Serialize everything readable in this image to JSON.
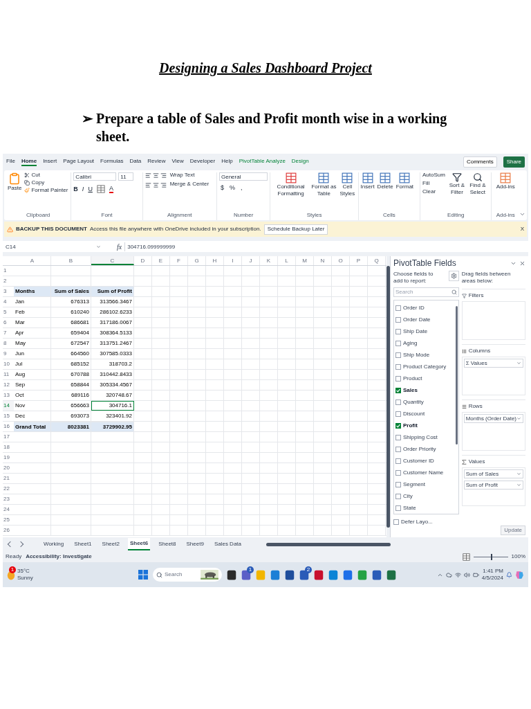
{
  "document": {
    "title": "Designing a Sales Dashboard Project",
    "bullets": [
      {
        "marker": "➢",
        "text": "Prepare a table of Sales and Profit month wise in a working sheet."
      }
    ]
  },
  "excel": {
    "ribbon_tabs": [
      {
        "label": "File",
        "selected": false,
        "kind": "normal"
      },
      {
        "label": "Home",
        "selected": true,
        "kind": "normal"
      },
      {
        "label": "Insert",
        "selected": false,
        "kind": "normal"
      },
      {
        "label": "Page Layout",
        "selected": false,
        "kind": "normal"
      },
      {
        "label": "Formulas",
        "selected": false,
        "kind": "normal"
      },
      {
        "label": "Data",
        "selected": false,
        "kind": "normal"
      },
      {
        "label": "Review",
        "selected": false,
        "kind": "normal"
      },
      {
        "label": "View",
        "selected": false,
        "kind": "normal"
      },
      {
        "label": "Developer",
        "selected": false,
        "kind": "normal"
      },
      {
        "label": "Help",
        "selected": false,
        "kind": "normal"
      },
      {
        "label": "PivotTable Analyze",
        "selected": false,
        "kind": "contextual"
      },
      {
        "label": "Design",
        "selected": false,
        "kind": "contextual"
      }
    ],
    "comments_button": "Comments",
    "share_button": "Share",
    "clipboard": {
      "label": "Clipboard",
      "paste": "Paste",
      "items": [
        "Cut",
        "Copy",
        "Format Painter"
      ]
    },
    "font": {
      "label": "Font",
      "name": "Calibri",
      "size": "11",
      "styles": [
        "B",
        "I",
        "U"
      ],
      "color_letter": "A"
    },
    "alignment": {
      "label": "Alignment",
      "items": [
        "Wrap Text",
        "Merge & Center"
      ]
    },
    "number": {
      "label": "Number",
      "format": "General",
      "symbols": [
        "$",
        "%",
        ","
      ]
    },
    "styles": {
      "label": "Styles",
      "items": [
        "Conditional Formatting",
        "Format as Table",
        "Cell Styles"
      ]
    },
    "cells": {
      "label": "Cells",
      "items": [
        "Insert",
        "Delete",
        "Format"
      ]
    },
    "editing": {
      "label": "Editing",
      "small": [
        "AutoSum",
        "Fill",
        "Clear"
      ],
      "large": [
        "Sort & Filter",
        "Find & Select"
      ]
    },
    "addins": {
      "label": "Add-ins",
      "items": [
        "Add-ins"
      ]
    },
    "notification": {
      "title": "BACKUP THIS DOCUMENT",
      "message": "Access this file anywhere with OneDrive included in your subscription.",
      "button": "Schedule Backup Later",
      "close": "X"
    },
    "formula_bar": {
      "name_box": "C14",
      "fx": "fx",
      "value": "304716.099999999"
    },
    "columns": [
      "A",
      "B",
      "C",
      "D",
      "E",
      "F",
      "G",
      "H",
      "I",
      "J",
      "K",
      "L",
      "M",
      "N",
      "O",
      "P",
      "Q"
    ],
    "row_numbers": [
      "1",
      "2",
      "3",
      "4",
      "5",
      "6",
      "7",
      "8",
      "9",
      "10",
      "11",
      "12",
      "13",
      "14",
      "15",
      "16",
      "17",
      "18",
      "19",
      "20",
      "21",
      "22",
      "23",
      "24",
      "25",
      "26"
    ],
    "pivot_table": {
      "headers": [
        "Months",
        "Sum of Sales",
        "Sum of Profit"
      ],
      "rows": [
        {
          "month": "Jan",
          "sales": "676313",
          "profit": "313566.3467",
          "selected": false
        },
        {
          "month": "Feb",
          "sales": "610240",
          "profit": "286102.6233",
          "selected": false
        },
        {
          "month": "Mar",
          "sales": "686681",
          "profit": "317186.0067",
          "selected": false
        },
        {
          "month": "Apr",
          "sales": "659404",
          "profit": "308364.5133",
          "selected": false
        },
        {
          "month": "May",
          "sales": "672547",
          "profit": "313751.2467",
          "selected": false
        },
        {
          "month": "Jun",
          "sales": "664560",
          "profit": "307585.0333",
          "selected": false
        },
        {
          "month": "Jul",
          "sales": "685152",
          "profit": "318703.2",
          "selected": false
        },
        {
          "month": "Aug",
          "sales": "670788",
          "profit": "310442.8433",
          "selected": false
        },
        {
          "month": "Sep",
          "sales": "658844",
          "profit": "305334.4567",
          "selected": false
        },
        {
          "month": "Oct",
          "sales": "689116",
          "profit": "320748.67",
          "selected": false
        },
        {
          "month": "Nov",
          "sales": "656663",
          "profit": "304716.1",
          "selected": true
        },
        {
          "month": "Dec",
          "sales": "693073",
          "profit": "323401.92",
          "selected": false
        }
      ],
      "total": {
        "month": "Grand Total",
        "sales": "8023381",
        "profit": "3729902.95"
      }
    },
    "sheet_tabs": [
      {
        "label": "Working",
        "selected": false
      },
      {
        "label": "Sheet1",
        "selected": false
      },
      {
        "label": "Sheet2",
        "selected": false
      },
      {
        "label": "Sheet6",
        "selected": true
      },
      {
        "label": "Sheet8",
        "selected": false
      },
      {
        "label": "Sheet9",
        "selected": false
      },
      {
        "label": "Sales Data",
        "selected": false
      }
    ],
    "pivot_fields": {
      "title": "PivotTable Fields",
      "choose": "Choose fields to add to report:",
      "search_placeholder": "Search",
      "drag_hint": "Drag fields between areas below:",
      "fields": [
        {
          "label": "Order ID",
          "checked": false
        },
        {
          "label": "Order Date",
          "checked": false
        },
        {
          "label": "Ship Date",
          "checked": false
        },
        {
          "label": "Aging",
          "checked": false
        },
        {
          "label": "Ship Mode",
          "checked": false
        },
        {
          "label": "Product Category",
          "checked": false
        },
        {
          "label": "Product",
          "checked": false
        },
        {
          "label": "Sales",
          "checked": true
        },
        {
          "label": "Quantity",
          "checked": false
        },
        {
          "label": "Discount",
          "checked": false
        },
        {
          "label": "Profit",
          "checked": true
        },
        {
          "label": "Shipping Cost",
          "checked": false
        },
        {
          "label": "Order Priority",
          "checked": false
        },
        {
          "label": "Customer ID",
          "checked": false
        },
        {
          "label": "Customer Name",
          "checked": false
        },
        {
          "label": "Segment",
          "checked": false
        },
        {
          "label": "City",
          "checked": false
        },
        {
          "label": "State",
          "checked": false
        }
      ],
      "areas": [
        {
          "label": "Filters",
          "kind": "filter"
        },
        {
          "label": "Columns",
          "kind": "columns",
          "items": [
            "Σ Values"
          ]
        },
        {
          "label": "Rows",
          "kind": "rows",
          "items": [
            "Months (Order Date)"
          ]
        },
        {
          "label": "Values",
          "kind": "values",
          "items": [
            "Sum of Sales",
            "Sum of Profit"
          ]
        }
      ],
      "defer": {
        "label": "Defer Layo...",
        "checked": false
      },
      "update_button": {
        "label": "Update",
        "disabled": true
      }
    },
    "status_bar": {
      "ready": "Ready",
      "accessibility": "Accessibility: Investigate",
      "zoom": "100%",
      "zoom_slider": {
        "level": 0.5
      }
    },
    "taskbar": {
      "temperature": "35°C",
      "weather": "Sunny",
      "weather_badge": "1",
      "search_placeholder": "Search",
      "apps": [
        {
          "color": "#2b2b2b"
        },
        {
          "color": "#5b5fc7",
          "badge": "1"
        },
        {
          "color": "#f2b600"
        },
        {
          "color": "#1b7fd6"
        },
        {
          "color": "#1f4e9c"
        },
        {
          "color": "#2a5bb8",
          "badge": "2"
        },
        {
          "color": "#c8102e"
        },
        {
          "color": "#0a84d6"
        },
        {
          "color": "#1e6fe8"
        },
        {
          "color": "#25a244"
        },
        {
          "color": "#2b5cb8"
        },
        {
          "color": "#1e7145"
        }
      ],
      "time": "1:41 PM",
      "date": "4/5/2024"
    }
  }
}
